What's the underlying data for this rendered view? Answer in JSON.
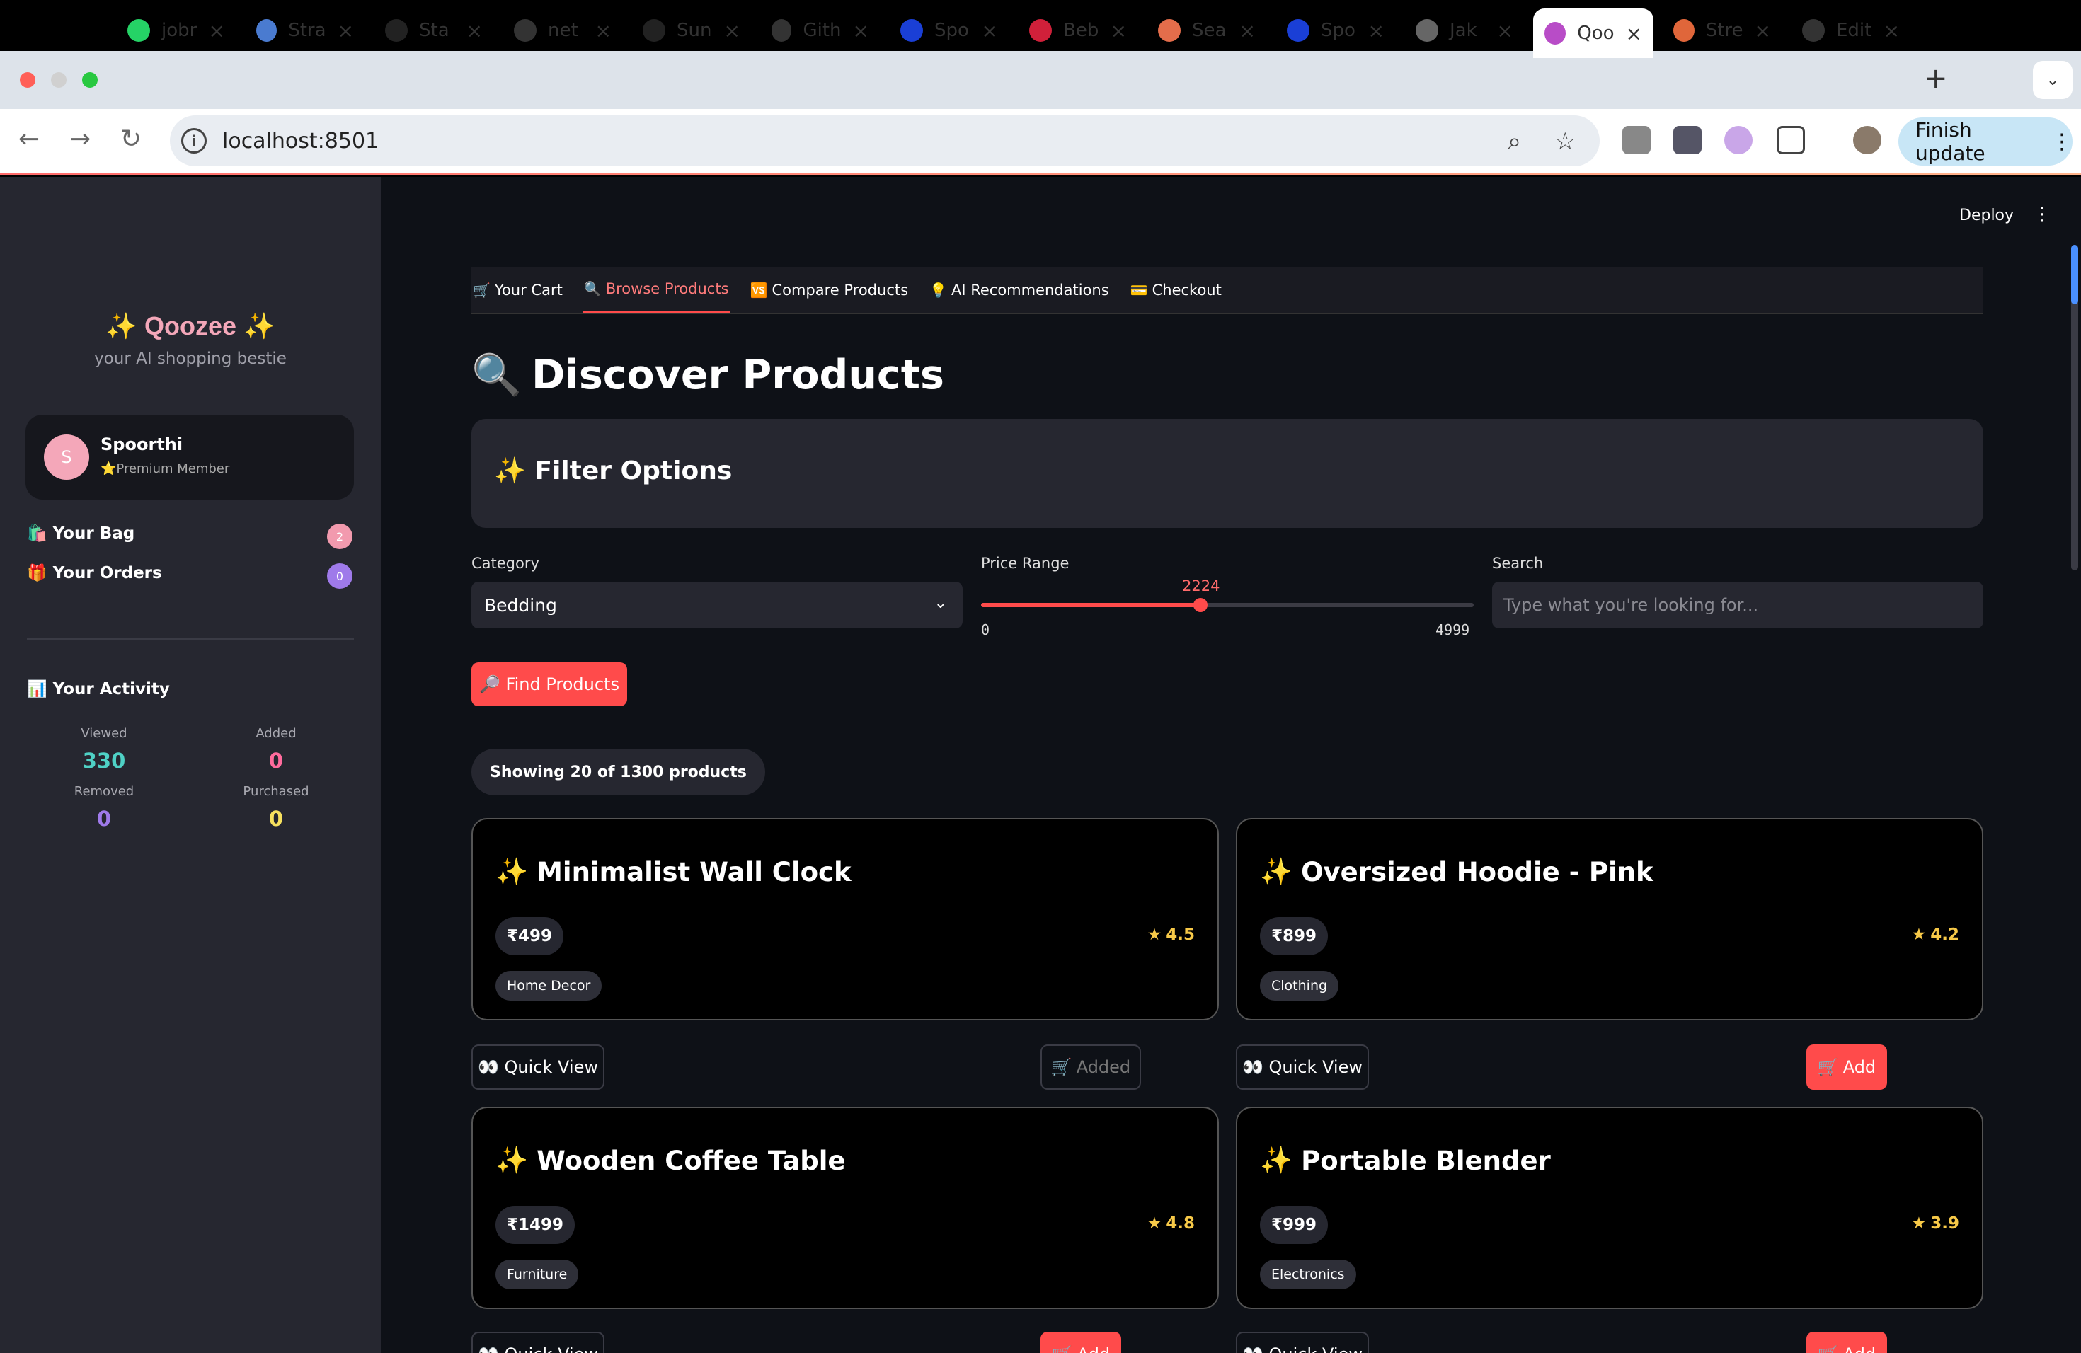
{
  "browser": {
    "tabs": [
      {
        "label": "jobr",
        "icon": "whatsapp-icon",
        "color": "#25d366"
      },
      {
        "label": "Stra",
        "icon": "swirl-icon",
        "color": "#4a7bd0"
      },
      {
        "label": "Sta",
        "icon": "w-icon",
        "color": "#222222"
      },
      {
        "label": "net",
        "icon": "github-icon",
        "color": "#333333"
      },
      {
        "label": "Sun",
        "icon": "react-icon",
        "color": "#222222"
      },
      {
        "label": "Gith",
        "icon": "openai-icon",
        "color": "#333333"
      },
      {
        "label": "Spo",
        "icon": "d-icon",
        "color": "#1a3fd6"
      },
      {
        "label": "Beb",
        "icon": "f-icon",
        "color": "#d0203a"
      },
      {
        "label": "Sea",
        "icon": "rainbow-icon",
        "color": "#e46d4b"
      },
      {
        "label": "Spo",
        "icon": "d-icon",
        "color": "#1a3fd6"
      },
      {
        "label": "Jak",
        "icon": "ring-icon",
        "color": "#666666"
      },
      {
        "label": "Qoo",
        "icon": "shopping-bag-icon",
        "color": "#b84cc7"
      },
      {
        "label": "Stre",
        "icon": "sparkle-icon",
        "color": "#e0663a"
      },
      {
        "label": "Edit",
        "icon": "github-icon",
        "color": "#333333"
      }
    ],
    "url": "localhost:8501",
    "finish_update": "Finish update"
  },
  "sidebar": {
    "brand": "✨ Qoozee ✨",
    "tagline": "your AI shopping bestie",
    "user": {
      "initial": "S",
      "name": "Spoorthi",
      "member": "⭐Premium Member"
    },
    "bag": {
      "label": "Your Bag",
      "icon": "🛍️",
      "count": "2"
    },
    "orders": {
      "label": "Your Orders",
      "icon": "🎁",
      "count": "0"
    },
    "activity_title": "📊 Your Activity",
    "stats": {
      "viewed_label": "Viewed",
      "viewed": "330",
      "added_label": "Added",
      "added": "0",
      "removed_label": "Removed",
      "removed": "0",
      "purchased_label": "Purchased",
      "purchased": "0"
    }
  },
  "header": {
    "deploy": "Deploy"
  },
  "nav_tabs": [
    {
      "icon": "🛒",
      "label": "Your Cart"
    },
    {
      "icon": "🔍",
      "label": "Browse Products"
    },
    {
      "icon": "🆚",
      "label": "Compare Products"
    },
    {
      "icon": "💡",
      "label": "AI Recommendations"
    },
    {
      "icon": "💳",
      "label": "Checkout"
    }
  ],
  "page": {
    "title_icon": "🔍",
    "title": "Discover Products",
    "filter_title": "✨ Filter Options",
    "category_label": "Category",
    "category_value": "Bedding",
    "price_label": "Price Range",
    "price_value": "2224",
    "price_min": "0",
    "price_max": "4999",
    "price_fraction": 0.4449,
    "search_label": "Search",
    "search_placeholder": "Type what you're looking for...",
    "find_button": "🔎 Find Products",
    "showing": "Showing 20 of 1300 products"
  },
  "products": [
    {
      "name": "Minimalist Wall Clock",
      "price": "₹499",
      "rating": "4.5",
      "category": "Home Decor",
      "add_label": "Added",
      "added": true
    },
    {
      "name": "Oversized Hoodie - Pink",
      "price": "₹899",
      "rating": "4.2",
      "category": "Clothing",
      "add_label": "Add",
      "added": false
    },
    {
      "name": "Wooden Coffee Table",
      "price": "₹1499",
      "rating": "4.8",
      "category": "Furniture",
      "add_label": "Add",
      "added": false
    },
    {
      "name": "Portable Blender",
      "price": "₹999",
      "rating": "3.9",
      "category": "Electronics",
      "add_label": "Add",
      "added": false
    }
  ],
  "quick_view_label": "👀 Quick View",
  "colors": {
    "accent": "#ff4b4b",
    "brand_pink": "#f4a7b9",
    "viewed": "#4fd1c5",
    "removed": "#9f7aea",
    "purchased": "#f6e05e"
  }
}
